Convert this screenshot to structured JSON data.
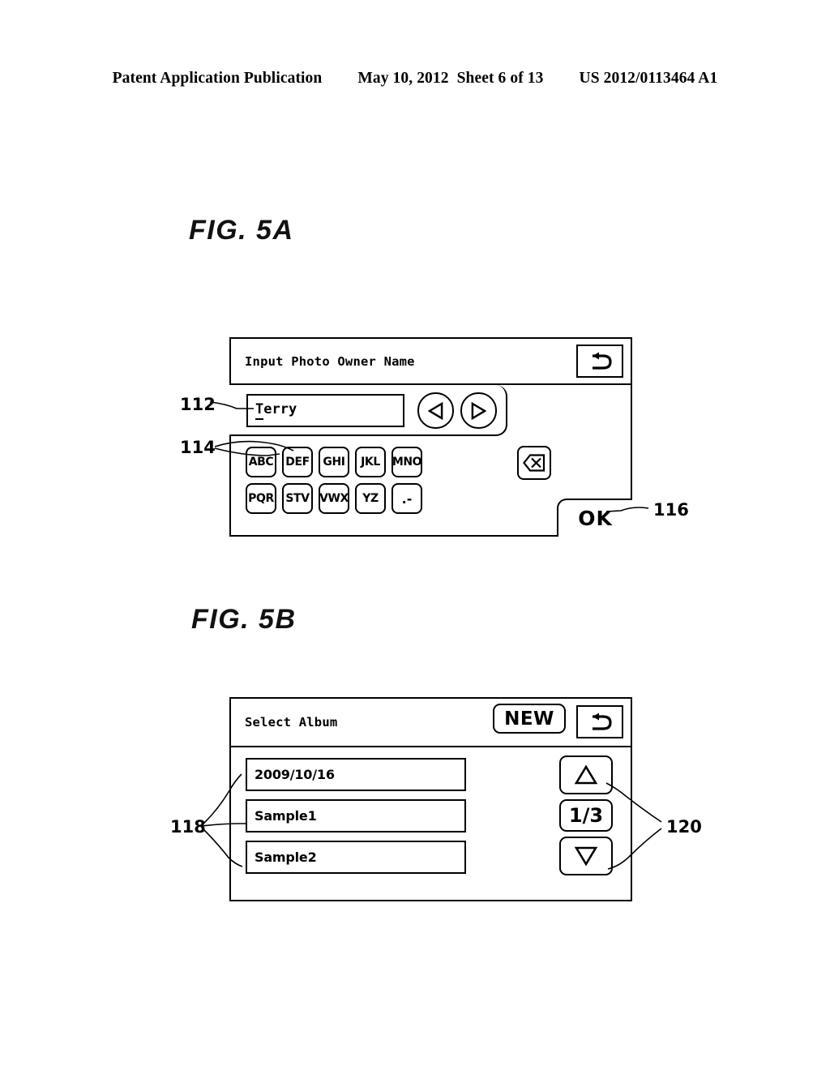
{
  "header": {
    "publication": "Patent Application Publication",
    "date": "May 10, 2012",
    "sheet": "Sheet 6 of 13",
    "patent_number": "US 2012/0113464 A1"
  },
  "figures": [
    {
      "caption": "FIG. 5A",
      "screen": {
        "title": "Input Photo Owner Name",
        "back_button_icon": "back-arrow-icon",
        "text_field": {
          "value": "Terry",
          "caret_char": "T",
          "rest_chars": "erry"
        },
        "cursor_left_icon": "triangle-left-icon",
        "cursor_right_icon": "triangle-right-icon",
        "keypad": {
          "rows": [
            [
              "ABC",
              "DEF",
              "GHI",
              "JKL",
              "MNO"
            ],
            [
              "PQR",
              "STV",
              "VWX",
              "YZ",
              ".-"
            ]
          ]
        },
        "backspace_icon": "backspace-delete-icon",
        "ok_label": "OK"
      },
      "reference_numerals": [
        {
          "id": "112",
          "target": "text-field"
        },
        {
          "id": "114",
          "target": "keypad-keys"
        },
        {
          "id": "116",
          "target": "ok-button"
        }
      ]
    },
    {
      "caption": "FIG. 5B",
      "screen": {
        "title": "Select Album",
        "new_label": "NEW",
        "back_button_icon": "back-arrow-icon",
        "albums": [
          "2009/10/16",
          "Sample1",
          "Sample2"
        ],
        "pager": {
          "up_icon": "triangle-up-icon",
          "count": "1/3",
          "down_icon": "triangle-down-icon"
        }
      },
      "reference_numerals": [
        {
          "id": "118",
          "target": "album-list-items"
        },
        {
          "id": "120",
          "target": "pager-buttons"
        }
      ]
    }
  ],
  "colors": {
    "ink": "#000000",
    "paper": "#ffffff"
  }
}
